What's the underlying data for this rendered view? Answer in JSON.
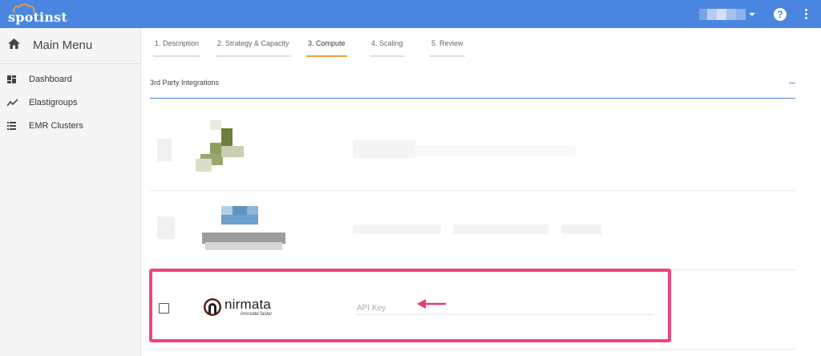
{
  "header": {
    "brand": "spotinst",
    "colors": {
      "topbar": "#4a86df",
      "accent": "#f39c3c",
      "highlight": "#f0457a"
    },
    "help_icon": "question-circle-icon",
    "more_icon": "vertical-dots-icon",
    "help_label": "?"
  },
  "sidebar": {
    "title": "Main Menu",
    "title_icon": "home-icon",
    "items": [
      {
        "label": "Dashboard",
        "icon": "dashboard-icon"
      },
      {
        "label": "Elastigroups",
        "icon": "trend-line-icon"
      },
      {
        "label": "EMR Clusters",
        "icon": "list-icon"
      }
    ]
  },
  "wizard": {
    "steps": [
      {
        "label": "1. Description",
        "active": false
      },
      {
        "label": "2. Strategy & Capacity",
        "active": false
      },
      {
        "label": "3. Compute",
        "active": true
      },
      {
        "label": "4. Scaling",
        "active": false
      },
      {
        "label": "5. Review",
        "active": false
      }
    ]
  },
  "section": {
    "title": "3rd Party Integrations",
    "collapse_icon": "minus-icon"
  },
  "integration": {
    "name": "nirmata",
    "tagline": "innovate faster",
    "api_key_placeholder": "API Key",
    "api_key_value": "",
    "checked": false
  }
}
